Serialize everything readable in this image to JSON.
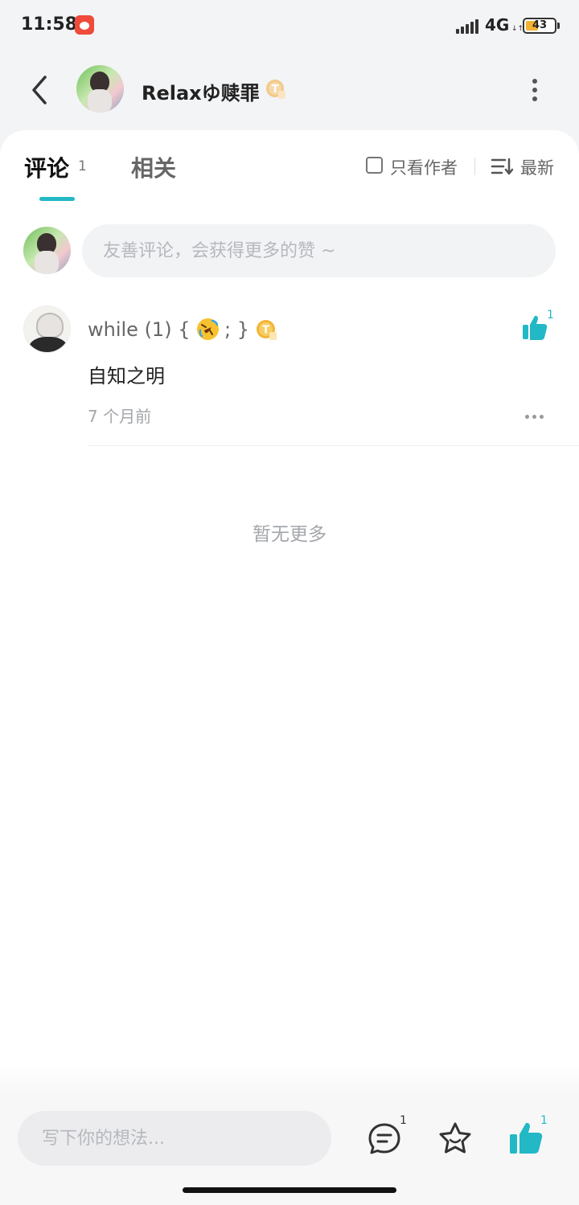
{
  "status_bar": {
    "time": "11:58",
    "network": "4G",
    "network_arrows": "↓↑",
    "battery_level": "43",
    "battery_percent": 43
  },
  "header": {
    "back_icon": "chevron-left-icon",
    "user_name": "Relaxゆ赎罪",
    "badge_icon": "level-badge-icon",
    "more_icon": "vertical-dots-icon"
  },
  "tabs": {
    "comments_label": "评论",
    "comments_count": "1",
    "related_label": "相关",
    "author_only_label": "只看作者",
    "sort_label": "最新",
    "accent_color": "#23b8c6"
  },
  "comment_box": {
    "placeholder": "友善评论，会获得更多的赞 ~"
  },
  "comments": [
    {
      "author_prefix": "while (1) {",
      "author_suffix": "; }",
      "emoji": "rolling-laugh-emoji",
      "text": "自知之明",
      "time": "7 个月前",
      "like_count": "1"
    }
  ],
  "empty_state": "暂无更多",
  "bottom_bar": {
    "input_placeholder": "写下你的想法...",
    "comment_count": "1",
    "like_count": "1"
  }
}
